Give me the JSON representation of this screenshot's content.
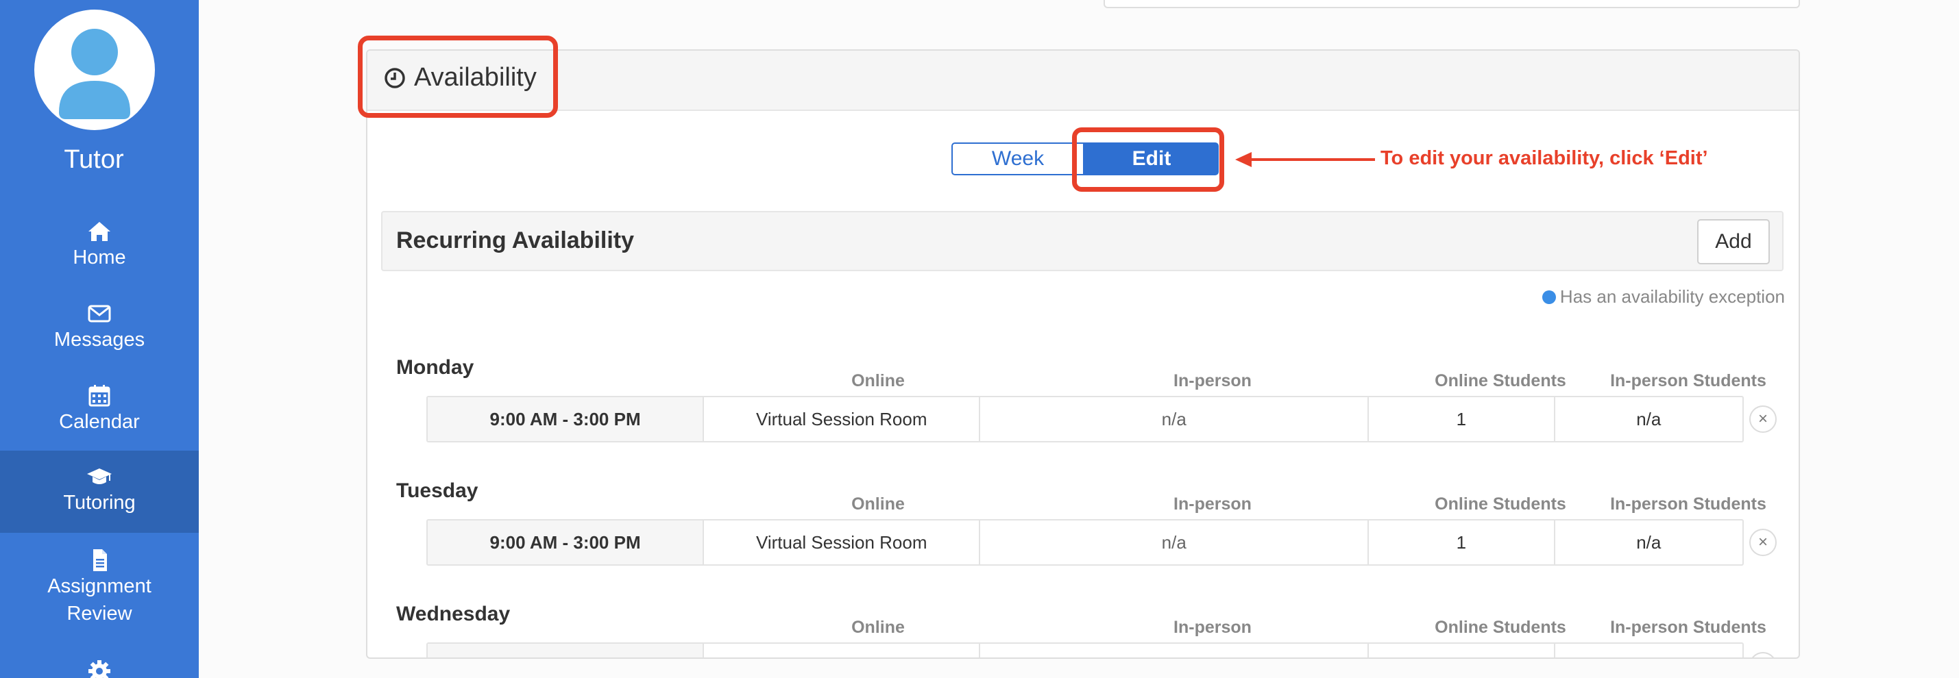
{
  "sidebar": {
    "user_role": "Tutor",
    "items": [
      {
        "label": "Home",
        "icon": "home-icon"
      },
      {
        "label": "Messages",
        "icon": "envelope-icon"
      },
      {
        "label": "Calendar",
        "icon": "calendar-icon"
      },
      {
        "label": "Tutoring",
        "icon": "graduation-cap-icon",
        "active": true
      },
      {
        "label": "Assignment",
        "label2": "Review",
        "icon": "document-icon"
      },
      {
        "label": "",
        "icon": "gear-icon"
      }
    ]
  },
  "panel": {
    "title": "Availability",
    "toggle": {
      "week": "Week",
      "edit": "Edit",
      "selected": "Edit"
    },
    "recurring": {
      "title": "Recurring Availability",
      "add_label": "Add"
    },
    "exception_legend": "Has an availability exception",
    "columns": {
      "online": "Online",
      "in_person": "In-person",
      "online_students": "Online Students",
      "in_person_students": "In-person Students"
    },
    "days": [
      {
        "day": "Monday",
        "time": "9:00 AM - 3:00 PM",
        "online": "Virtual Session Room",
        "in_person": "n/a",
        "online_students": "1",
        "in_person_students": "n/a"
      },
      {
        "day": "Tuesday",
        "time": "9:00 AM - 3:00 PM",
        "online": "Virtual Session Room",
        "in_person": "n/a",
        "online_students": "1",
        "in_person_students": "n/a"
      },
      {
        "day": "Wednesday",
        "time": "",
        "online": "",
        "in_person": "",
        "online_students": "",
        "in_person_students": ""
      }
    ],
    "remove_symbol": "×"
  },
  "annotation": {
    "text": "To edit your availability, click ‘Edit’",
    "color": "#e8402a"
  },
  "colors": {
    "sidebar": "#3a78d6",
    "sidebar_active": "#2e64b4",
    "primary": "#2e6fd1",
    "annotation": "#e8402a"
  }
}
